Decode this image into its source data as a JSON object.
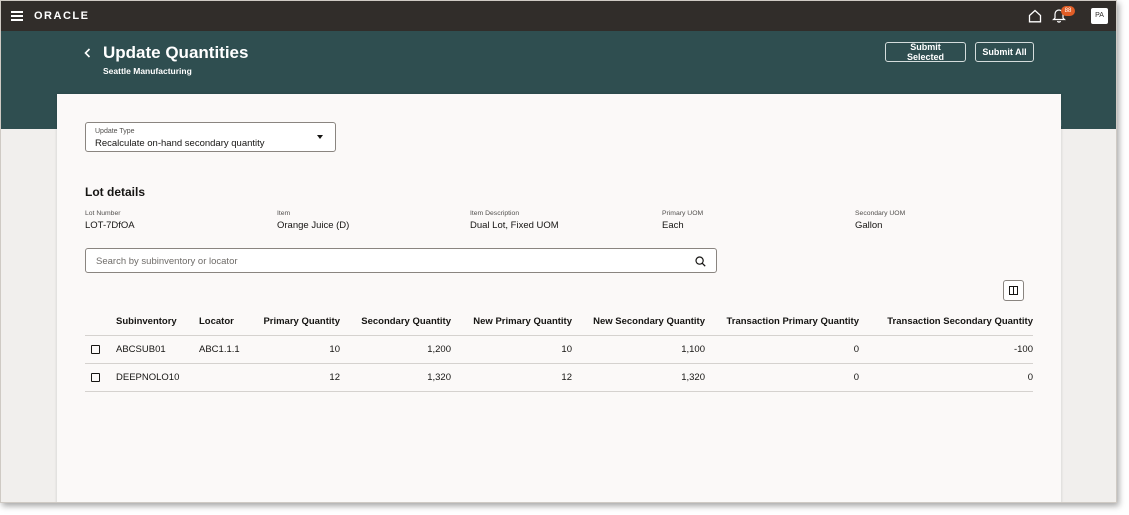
{
  "topbar": {
    "logo": "ORACLE",
    "notification_count": "88",
    "avatar_initials": "PA"
  },
  "header": {
    "title": "Update Quantities",
    "subtitle": "Seattle Manufacturing",
    "submit_selected": "Submit Selected",
    "submit_all": "Submit All"
  },
  "update_type": {
    "label": "Update Type",
    "value": "Recalculate on-hand secondary quantity"
  },
  "lot_details": {
    "title": "Lot details",
    "fields": [
      {
        "label": "Lot Number",
        "value": "LOT-7DfOA"
      },
      {
        "label": "Item",
        "value": "Orange Juice (D)"
      },
      {
        "label": "Item Description",
        "value": "Dual Lot, Fixed UOM"
      },
      {
        "label": "Primary UOM",
        "value": "Each"
      },
      {
        "label": "Secondary UOM",
        "value": "Gallon"
      }
    ]
  },
  "search": {
    "placeholder": "Search by subinventory or locator"
  },
  "table": {
    "columns": [
      "Subinventory",
      "Locator",
      "Primary Quantity",
      "Secondary Quantity",
      "New Primary Quantity",
      "New Secondary Quantity",
      "Transaction Primary Quantity",
      "Transaction Secondary Quantity"
    ],
    "rows": [
      [
        "ABCSUB01",
        "ABC1.1.1",
        "10",
        "1,200",
        "10",
        "1,100",
        "0",
        "-100"
      ],
      [
        "DEEPNOLO10",
        "",
        "12",
        "1,320",
        "12",
        "1,320",
        "0",
        "0"
      ]
    ]
  },
  "colors": {
    "topbar_bg": "#312d2a",
    "header_bg": "#2f4e50",
    "badge": "#e05d26",
    "page_bg": "#f1efed"
  }
}
